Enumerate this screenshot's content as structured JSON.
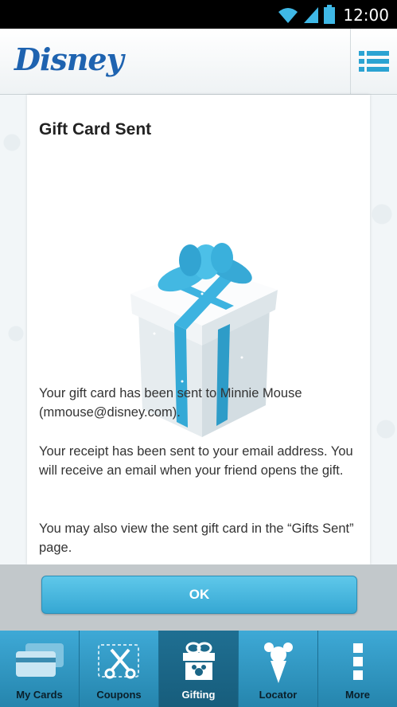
{
  "status": {
    "time": "12:00"
  },
  "header": {
    "logo": "Disney"
  },
  "card": {
    "title": "Gift Card Sent",
    "message1": "Your gift card has been sent to Minnie Mouse (mmouse@disney.com).",
    "message2": "Your receipt has been sent to your email address. You will receive an email when your friend opens the gift.",
    "message3": "You may also view the sent gift card in the “Gifts Sent” page."
  },
  "ok_button": {
    "label": "OK"
  },
  "tabs": [
    {
      "label": "My Cards",
      "icon": "cards-icon"
    },
    {
      "label": "Coupons",
      "icon": "scissors-icon"
    },
    {
      "label": "Gifting",
      "icon": "gift-icon"
    },
    {
      "label": "Locator",
      "icon": "ice-cream-icon"
    },
    {
      "label": "More",
      "icon": "more-icon"
    }
  ],
  "colors": {
    "accent": "#3ba8d6",
    "brand": "#1e63b0",
    "active_tab": "#1a6586"
  }
}
